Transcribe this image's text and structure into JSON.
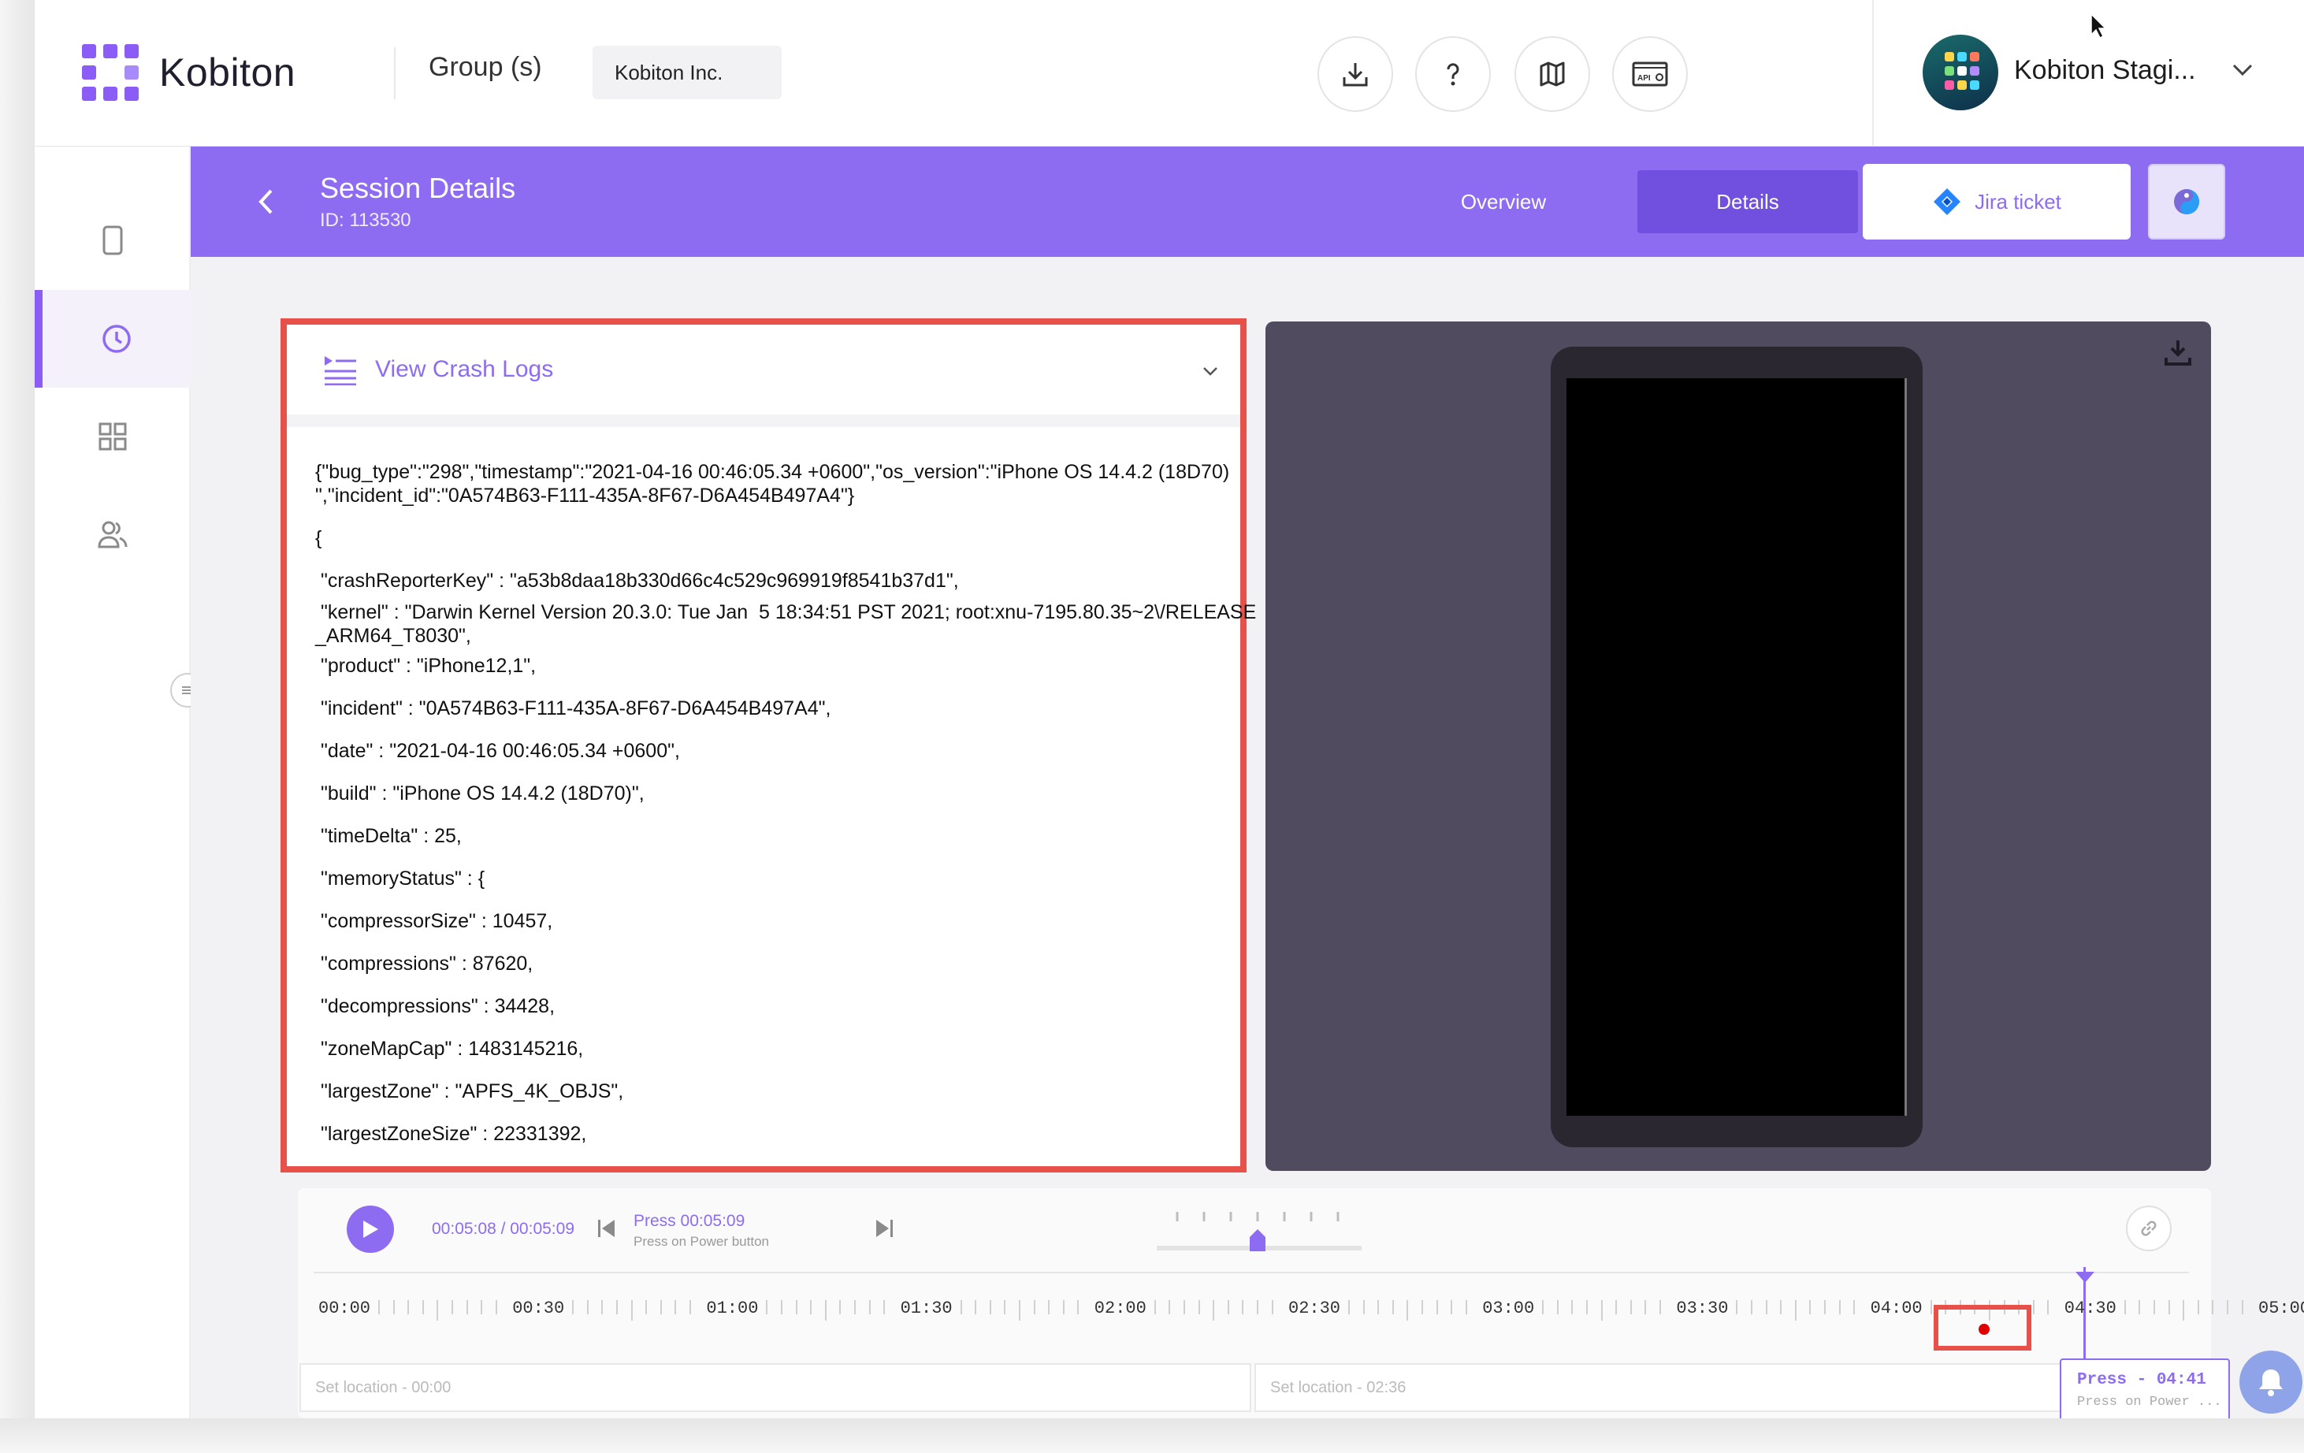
{
  "topbar": {
    "logo_text": "Kobiton",
    "group_label": "Group (s)",
    "group_value": "Kobiton Inc.",
    "icons": [
      "download-icon",
      "help-icon",
      "map-icon",
      "api-settings-icon"
    ],
    "api_badge": "API",
    "profile_name": "Kobiton Stagi..."
  },
  "sidebar": {
    "items": [
      {
        "icon": "device-icon"
      },
      {
        "icon": "clock-icon",
        "active": true
      },
      {
        "icon": "grid-icon"
      },
      {
        "icon": "users-icon"
      }
    ]
  },
  "header": {
    "title": "Session Details",
    "session_id": "ID: 113530",
    "tabs": [
      {
        "label": "Overview",
        "active": false
      },
      {
        "label": "Details",
        "active": true
      }
    ],
    "jira_label": "Jira ticket"
  },
  "crash_logs": {
    "title": "View Crash Logs",
    "lines": [
      "{\"bug_type\":\"298\",\"timestamp\":\"2021-04-16 00:46:05.34 +0600\",\"os_version\":\"iPhone OS 14.4.2 (18D70)",
      "\",\"incident_id\":\"0A574B63-F111-435A-8F67-D6A454B497A4\"}",
      "{",
      " \"crashReporterKey\" : \"a53b8daa18b330d66c4c529c969919f8541b37d1\",",
      " \"kernel\" : \"Darwin Kernel Version 20.3.0: Tue Jan  5 18:34:51 PST 2021; root:xnu-7195.80.35~2\\/RELEASE",
      "_ARM64_T8030\",",
      " \"product\" : \"iPhone12,1\",",
      " \"incident\" : \"0A574B63-F111-435A-8F67-D6A454B497A4\",",
      " \"date\" : \"2021-04-16 00:46:05.34 +0600\",",
      " \"build\" : \"iPhone OS 14.4.2 (18D70)\",",
      " \"timeDelta\" : 25,",
      " \"memoryStatus\" : {",
      " \"compressorSize\" : 10457,",
      " \"compressions\" : 87620,",
      " \"decompressions\" : 34428,",
      " \"zoneMapCap\" : 1483145216,",
      " \"largestZone\" : \"APFS_4K_OBJS\",",
      " \"largestZoneSize\" : 22331392,"
    ]
  },
  "player": {
    "time": "00:05:08 / 00:05:09",
    "action_title": "Press 00:05:09",
    "action_subtitle": "Press on Power button",
    "speed_level": 0.5,
    "timeline_labels": [
      "00:00",
      "00:30",
      "01:00",
      "01:30",
      "02:00",
      "02:30",
      "03:00",
      "03:30",
      "04:00",
      "04:30",
      "05:00"
    ],
    "playhead_fraction": 0.998,
    "locations": [
      "Set location - 00:00",
      "Set location - 02:36"
    ],
    "press_card_title": "Press - 04:41",
    "press_card_subtitle": "Press on Power ..."
  }
}
